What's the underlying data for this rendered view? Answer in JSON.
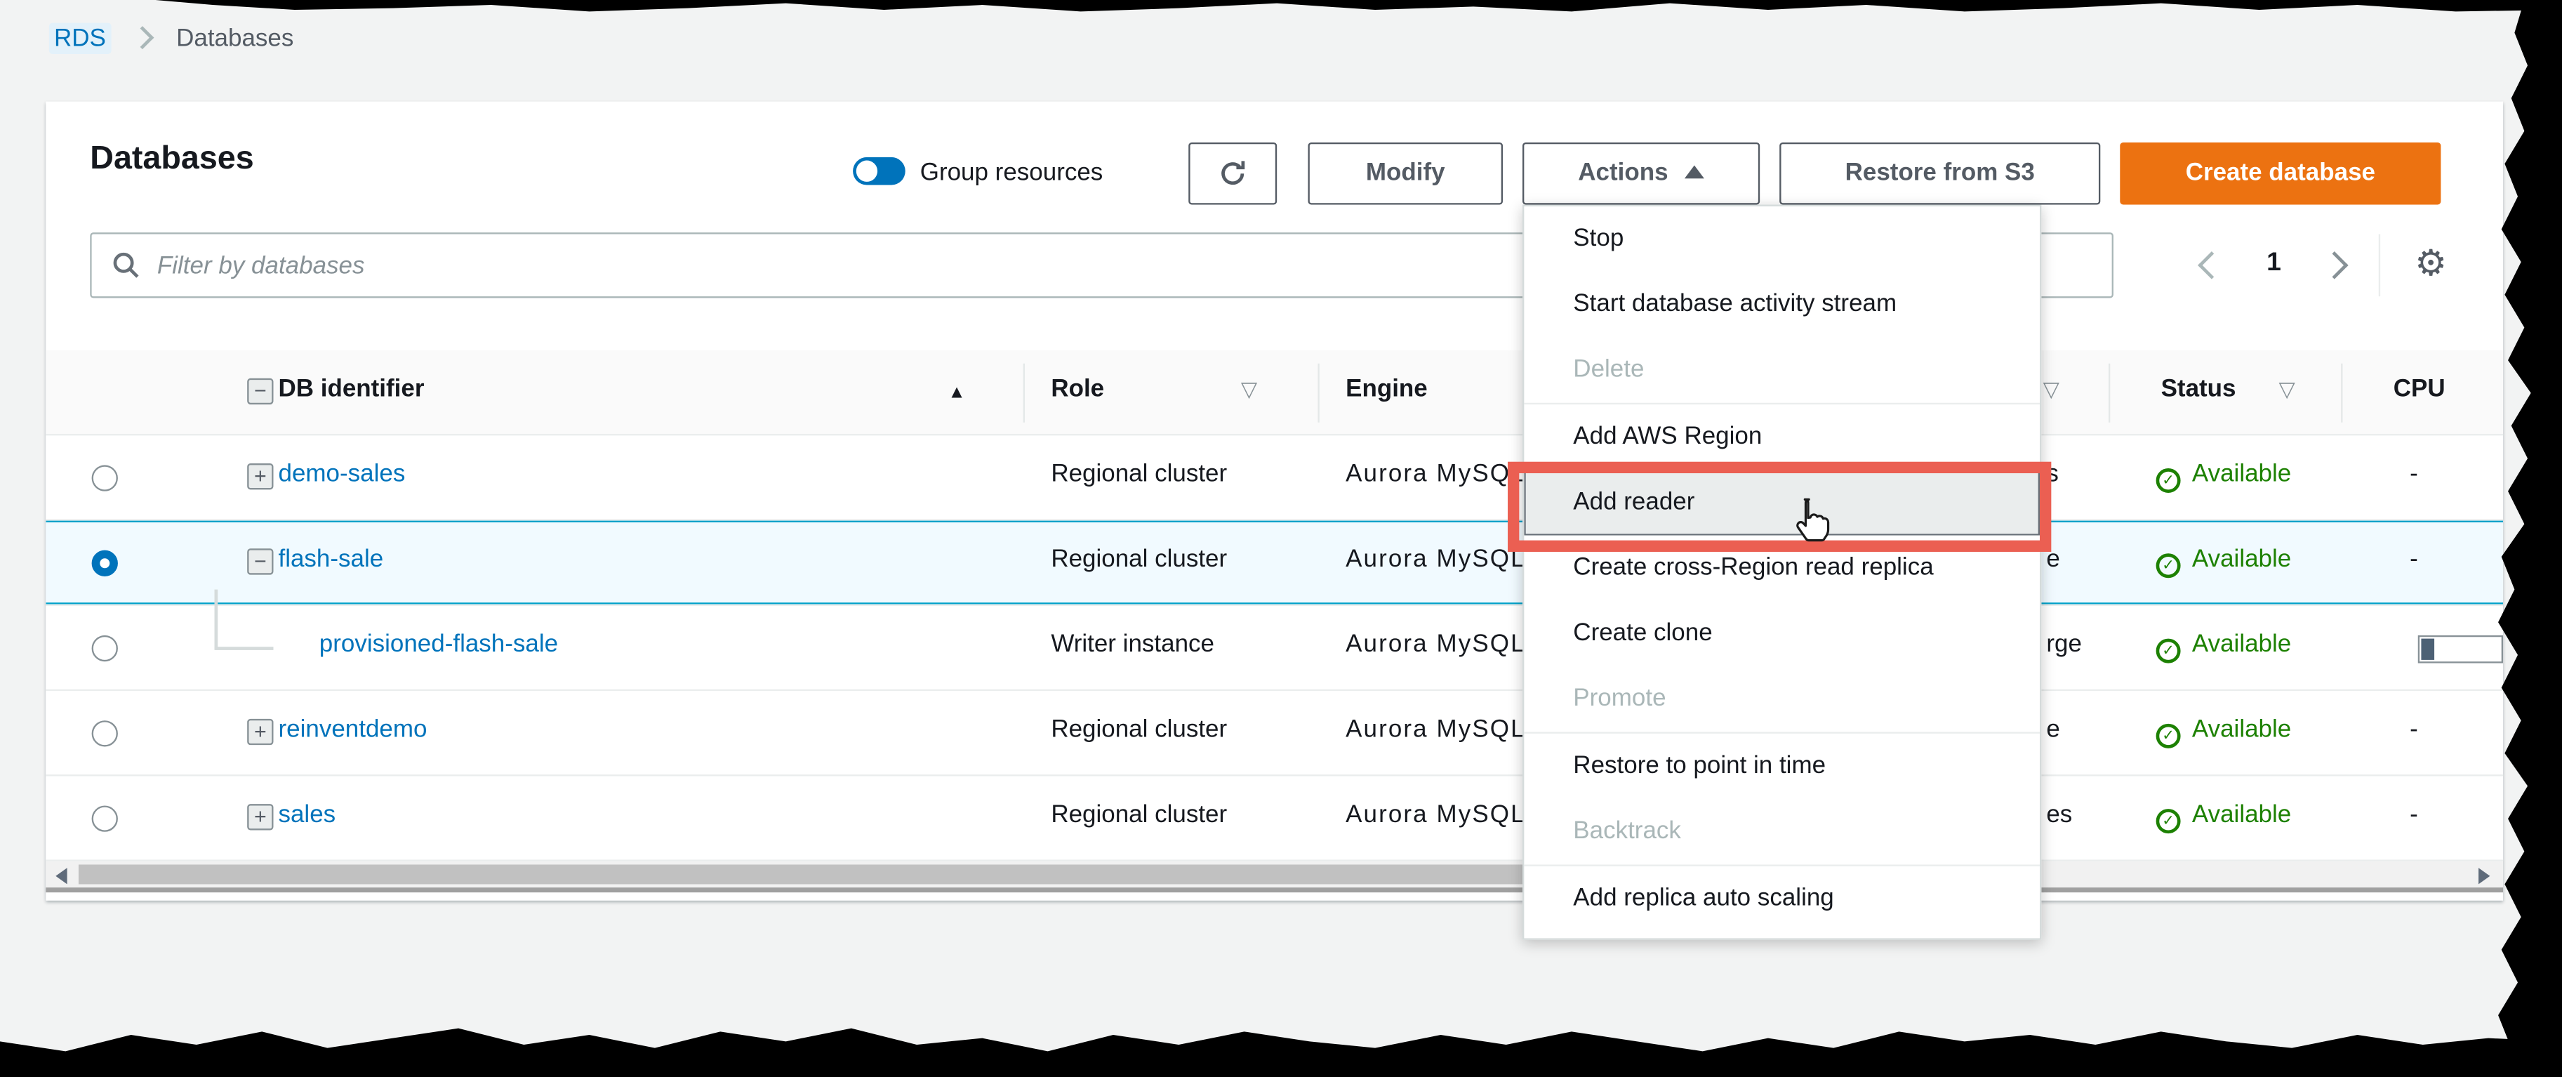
{
  "breadcrumb": {
    "items": [
      {
        "label": "RDS"
      },
      {
        "label": "Databases"
      }
    ]
  },
  "header": {
    "title": "Databases",
    "group_resources_label": "Group resources",
    "buttons": {
      "modify": "Modify",
      "actions": "Actions",
      "restore_from_s3": "Restore from S3",
      "create_database": "Create database"
    }
  },
  "filter": {
    "placeholder": "Filter by databases"
  },
  "pagination": {
    "page": "1"
  },
  "table": {
    "columns": {
      "db_identifier": "DB identifier",
      "role": "Role",
      "engine": "Engine",
      "status": "Status",
      "cpu": "CPU"
    },
    "rows": [
      {
        "id": "demo-sales",
        "role": "Regional cluster",
        "engine": "Aurora MySQL",
        "size_fragment": "s",
        "status": "Available",
        "cpu": "-"
      },
      {
        "id": "flash-sale",
        "role": "Regional cluster",
        "engine": "Aurora MySQL",
        "size_fragment": "e",
        "status": "Available",
        "cpu": "-",
        "selected": true
      },
      {
        "id": "provisioned-flash-sale",
        "role": "Writer instance",
        "engine": "Aurora MySQL",
        "size_fragment": "rge",
        "status": "Available",
        "cpu": ""
      },
      {
        "id": "reinventdemo",
        "role": "Regional cluster",
        "engine": "Aurora MySQL",
        "size_fragment": "e",
        "status": "Available",
        "cpu": "-"
      },
      {
        "id": "sales",
        "role": "Regional cluster",
        "engine": "Aurora MySQL",
        "size_fragment": "es",
        "status": "Available",
        "cpu": "-"
      }
    ]
  },
  "menu": {
    "items": [
      {
        "label": "Stop",
        "disabled": false
      },
      {
        "label": "Start database activity stream",
        "disabled": false
      },
      {
        "label": "Delete",
        "disabled": true
      },
      {
        "label": "Add AWS Region",
        "disabled": false
      },
      {
        "label": "Add reader",
        "disabled": false,
        "highlighted": true
      },
      {
        "label": "Create cross-Region read replica",
        "disabled": false
      },
      {
        "label": "Create clone",
        "disabled": false
      },
      {
        "label": "Promote",
        "disabled": true
      },
      {
        "label": "Restore to point in time",
        "disabled": false
      },
      {
        "label": "Backtrack",
        "disabled": true
      },
      {
        "label": "Add replica auto scaling",
        "disabled": false
      }
    ]
  },
  "colors": {
    "accent_orange": "#ec7211",
    "link_blue": "#0073bb",
    "status_green": "#1d8102",
    "annotation_red": "#eb5f52",
    "selected_row_bg": "#f1faff",
    "selected_row_border": "#00a1c9"
  }
}
